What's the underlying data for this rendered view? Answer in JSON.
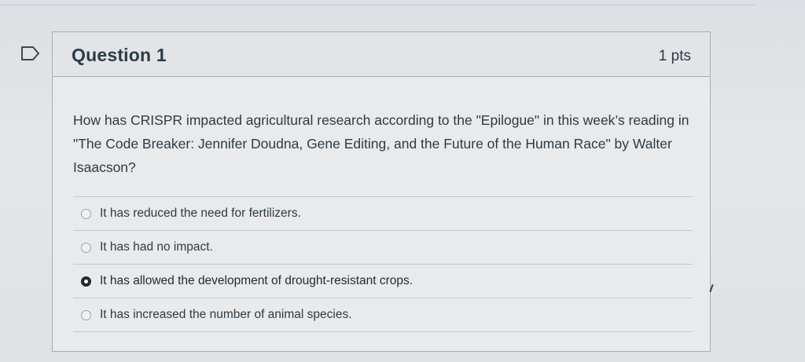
{
  "question": {
    "title": "Question 1",
    "points": "1 pts",
    "text": "How has CRISPR impacted agricultural research according to the \"Epilogue\" in this week’s reading in \"The Code Breaker: Jennifer Doudna, Gene Editing, and the Future of the Human Race\" by Walter Isaacson?"
  },
  "answers": [
    {
      "label": "It has reduced the need for fertilizers.",
      "selected": false
    },
    {
      "label": "It has had no impact.",
      "selected": false
    },
    {
      "label": "It has allowed the development of drought-resistant crops.",
      "selected": true
    },
    {
      "label": "It has increased the number of animal species.",
      "selected": false
    }
  ],
  "icons": {
    "flag": "flag-question-icon",
    "radio": "radio-icon"
  }
}
